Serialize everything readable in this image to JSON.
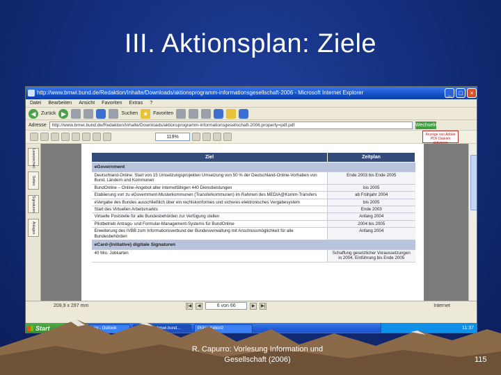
{
  "slide": {
    "title": "III. Aktionsplan: Ziele",
    "footer": "R. Capurro: Vorlesung Information und Gesellschaft (2006)",
    "page_number": "115"
  },
  "browser": {
    "window_title": "http://www.bmwi.bund.de/Redaktion/Inhalte/Downloads/aktionsprogramm-informationsgesellschaft-2006 - Microsoft Internet Explorer",
    "menu": [
      "Datei",
      "Bearbeiten",
      "Ansicht",
      "Favoriten",
      "Extras",
      "?"
    ],
    "toolbar": {
      "back": "Zurück",
      "search": "Suchen",
      "favorites": "Favoriten"
    },
    "address_label": "Adresse",
    "address_value": "http://www.bmwi.bund.de/Redaktion/Inhalte/Downloads/aktionsprogramm-informationsgesellschaft-2006,property=pdf.pdf",
    "go_label": "Wechseln zu",
    "zoom": "119%",
    "adobe_banner": "Anzeige von Adobe PDF Dateien aktivieren",
    "side_tabs": [
      "Lesezeichen",
      "Seiten",
      "Signaturen",
      "Anlagen"
    ],
    "status": {
      "page_size": "209,9 x 297 mm",
      "page_counter": "6 von 66",
      "zone": "Internet"
    }
  },
  "table": {
    "headers": [
      "Ziel",
      "Zeitplan"
    ],
    "rows": [
      {
        "type": "section",
        "ziel": "eGovernment",
        "zeit": ""
      },
      {
        "type": "row",
        "ziel": "Deutschland-Online: Start von 15 Umsetzungsprojekten Umsetzung von 50 % der Deutschland-Online-Vorhaben von Bund, Ländern und Kommunen",
        "zeit": "Ende 2003 bis Ende 2005"
      },
      {
        "type": "row",
        "ziel": "BundOnline – Online-Angebot aller internetfähigen 440 Dienstleistungen",
        "zeit": "bis 2005"
      },
      {
        "type": "row",
        "ziel": "Etablierung von zu eGovernment-Musterkommunen (Transferkommunen) im Rahmen des MEDIA@Komm-Transfers",
        "zeit": "ab Frühjahr 2004"
      },
      {
        "type": "row",
        "ziel": "eVergabe des Bundes ausschließlich über ein rechtskonformes und sicheres elektronisches Vergabesystem",
        "zeit": "bis 2005"
      },
      {
        "type": "row",
        "ziel": "Start des Virtuellen Arbeitsmarkts",
        "zeit": "Ende 2003"
      },
      {
        "type": "row",
        "ziel": "Virtuelle Poststelle für alle Bundesbehörden zur Verfügung stellen",
        "zeit": "Anfang 2004"
      },
      {
        "type": "row",
        "ziel": "Pilotbetrieb Antrags- und Formular-Management-Systems für BundOnline",
        "zeit": "2004 bis 2005"
      },
      {
        "type": "row",
        "ziel": "Erweiterung des IVBB zum Informationsverbund der Bundesverwaltung mit Anschlussmöglichkeit für alle Bundesbehörden",
        "zeit": "Anfang 2004"
      },
      {
        "type": "section",
        "ziel": "eCard-(Initiative) digitale Signaturen",
        "zeit": ""
      },
      {
        "type": "row",
        "ziel": "40 Mio. Jobkarten",
        "zeit": "Schaffung gesetzlicher Voraussetzungen in 2004, Einführung bis Ende 2005"
      }
    ]
  },
  "taskbar": {
    "start": "Start",
    "tasks": [
      "Posteingang - Outlook",
      "http://www.bmwi.bund...",
      "Präsentation2"
    ],
    "tray_time": "11:37"
  },
  "colors": {
    "background": "#14307f",
    "table_header": "#344a78",
    "section_row": "#b9c4dc",
    "taskbar": "#245edb"
  }
}
